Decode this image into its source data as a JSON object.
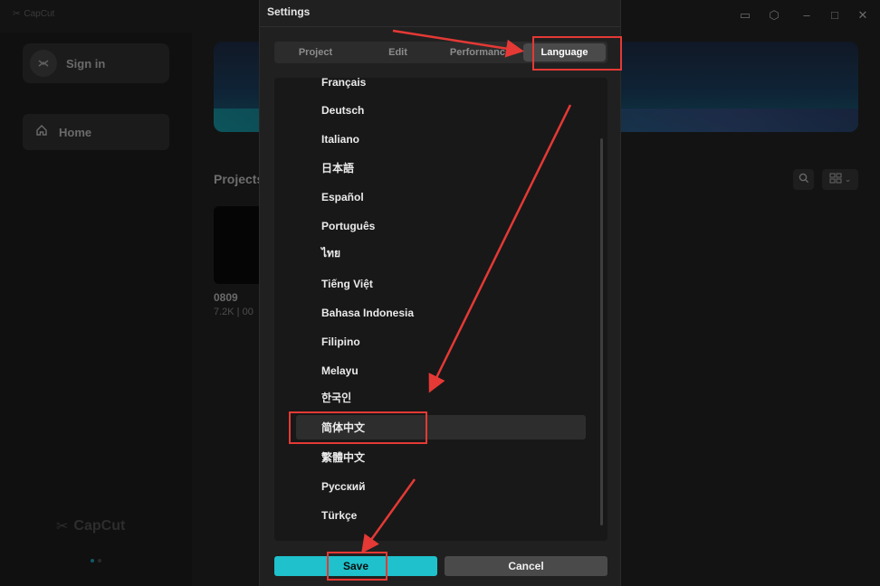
{
  "app": {
    "brand": "CapCut",
    "sidebar": {
      "sign_in": "Sign in",
      "home": "Home"
    },
    "main": {
      "projects_title": "Projects",
      "project": {
        "name": "0809",
        "meta": "7.2K | 00"
      }
    }
  },
  "settings": {
    "title": "Settings",
    "tabs": [
      {
        "label": "Project",
        "active": false
      },
      {
        "label": "Edit",
        "active": false
      },
      {
        "label": "Performance",
        "active": false
      },
      {
        "label": "Language",
        "active": true
      }
    ],
    "languages": [
      "Français",
      "Deutsch",
      "Italiano",
      "日本語",
      "Español",
      "Português",
      "ไทย",
      "Tiếng Việt",
      "Bahasa Indonesia",
      "Filipino",
      "Melayu",
      "한국인",
      "简体中文",
      "繁體中文",
      "Русский",
      "Türkçe"
    ],
    "selected_language": "简体中文",
    "save_label": "Save",
    "cancel_label": "Cancel"
  },
  "colors": {
    "accent": "#1ec1cc",
    "annotation": "#e53935"
  },
  "icons": [
    "monitor-icon",
    "hexagon-settings-icon",
    "minimize-icon",
    "maximize-icon",
    "close-icon",
    "user-icon",
    "home-icon",
    "search-icon",
    "grid-view-icon"
  ]
}
